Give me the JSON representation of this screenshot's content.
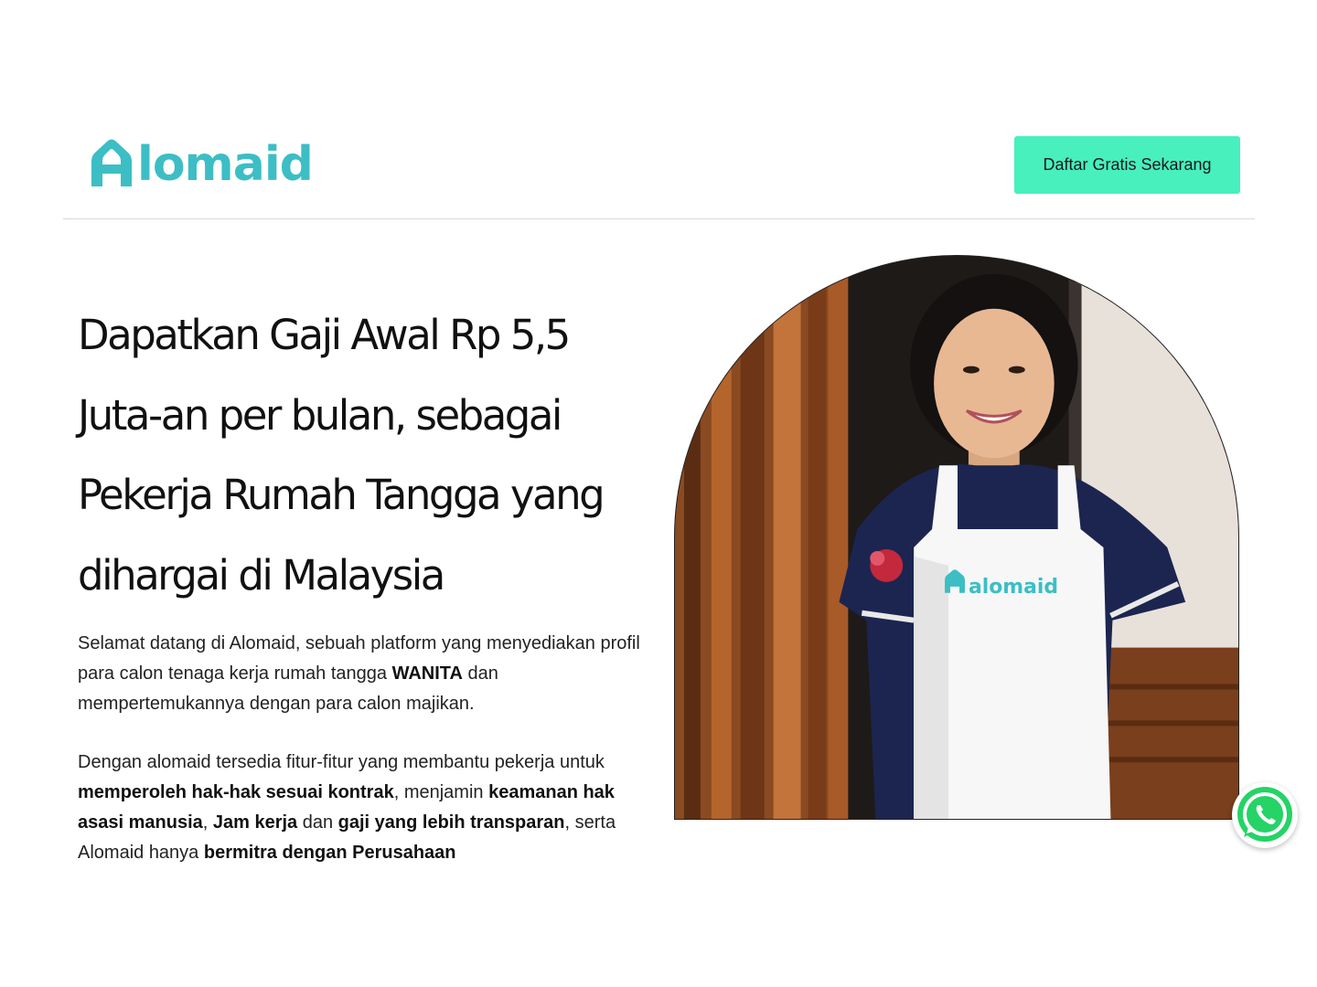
{
  "header": {
    "logo_text": "lomaid",
    "cta_label": "Daftar Gratis Sekarang"
  },
  "hero": {
    "headline": "Dapatkan Gaji Awal Rp 5,5 Juta-an per bulan, sebagai Pekerja Rumah Tangga yang dihargai di Malaysia",
    "para1": {
      "t1": "Selamat datang di Alomaid, sebuah platform yang menyediakan profil para calon tenaga kerja rumah tangga ",
      "b1": "WANITA",
      "t2": " dan mempertemukannya dengan para calon majikan."
    },
    "para2": {
      "t1": "Dengan alomaid tersedia fitur-fitur yang membantu pekerja untuk ",
      "b1": "memperoleh hak-hak sesuai kontrak",
      "t2": ", menjamin ",
      "b2": "keamanan hak asasi manusia",
      "t3": ", ",
      "b3": "Jam kerja",
      "t4": " dan ",
      "b4": "gaji yang lebih transparan",
      "t5": ", serta Alomaid hanya ",
      "b5": "bermitra dengan Perusahaan"
    },
    "apron_logo_text": "alomaid"
  },
  "icons": {
    "logo": "house-a-icon",
    "whatsapp": "whatsapp-icon"
  },
  "colors": {
    "brand": "#3cbec4",
    "cta": "#47f0bd",
    "whatsapp": "#25d366"
  }
}
